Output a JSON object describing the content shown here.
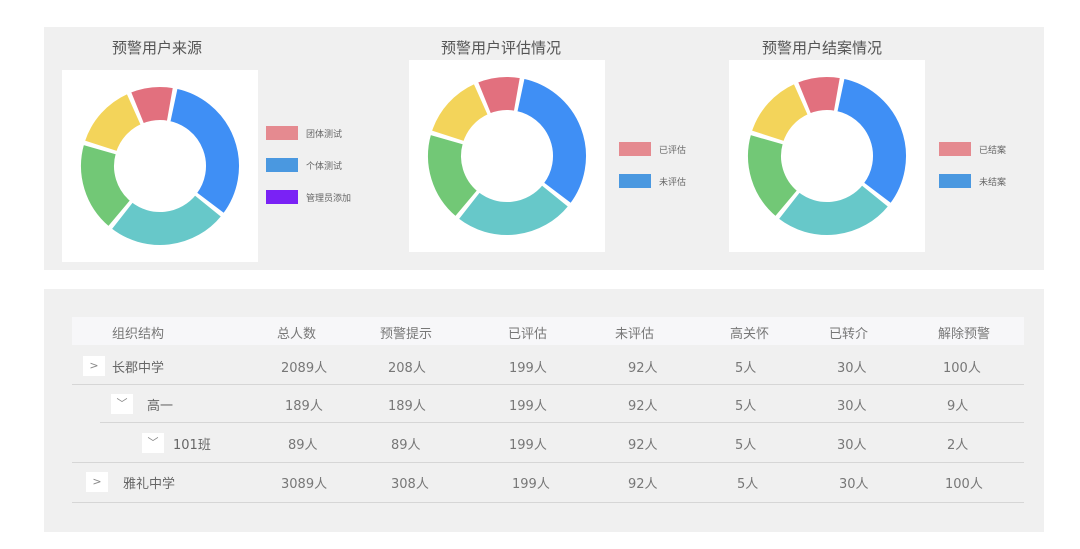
{
  "charts": [
    {
      "title": "预警用户来源",
      "legend": [
        {
          "label": "团体测试",
          "color": "#e58a90"
        },
        {
          "label": "个体测试",
          "color": "#4a98e0"
        },
        {
          "label": "管理员添加",
          "color": "#7a22f5"
        }
      ]
    },
    {
      "title": "预警用户评估情况",
      "legend": [
        {
          "label": "已评估",
          "color": "#e58a90"
        },
        {
          "label": "未评估",
          "color": "#4a98e0"
        }
      ]
    },
    {
      "title": "预警用户结案情况",
      "legend": [
        {
          "label": "已结案",
          "color": "#e58a90"
        },
        {
          "label": "未结案",
          "color": "#4a98e0"
        }
      ]
    }
  ],
  "donut_segments": [
    {
      "color": "#e2707e",
      "start": 338,
      "end": 10
    },
    {
      "color": "#3f8ff5",
      "start": 12,
      "end": 127
    },
    {
      "color": "#67c8c9",
      "start": 129,
      "end": 218
    },
    {
      "color": "#72c876",
      "start": 220,
      "end": 286
    },
    {
      "color": "#f3d45a",
      "start": 288,
      "end": 336
    }
  ],
  "table": {
    "headers": [
      "组织结构",
      "总人数",
      "预警提示",
      "已评估",
      "未评估",
      "高关怀",
      "已转介",
      "解除预警"
    ],
    "rows": [
      {
        "toggle": ">",
        "name": "长郡中学",
        "cells": [
          "2089人",
          "208人",
          "199人",
          "92人",
          "5人",
          "30人",
          "100人"
        ]
      },
      {
        "toggle": "﹀",
        "name": "高一",
        "cells": [
          "189人",
          "189人",
          "199人",
          "92人",
          "5人",
          "30人",
          "9人"
        ]
      },
      {
        "toggle": "﹀",
        "name": "101班",
        "cells": [
          "89人",
          "89人",
          "199人",
          "92人",
          "5人",
          "30人",
          "2人"
        ]
      },
      {
        "toggle": ">",
        "name": "雅礼中学",
        "cells": [
          "3089人",
          "308人",
          "199人",
          "92人",
          "5人",
          "30人",
          "100人"
        ]
      }
    ]
  }
}
